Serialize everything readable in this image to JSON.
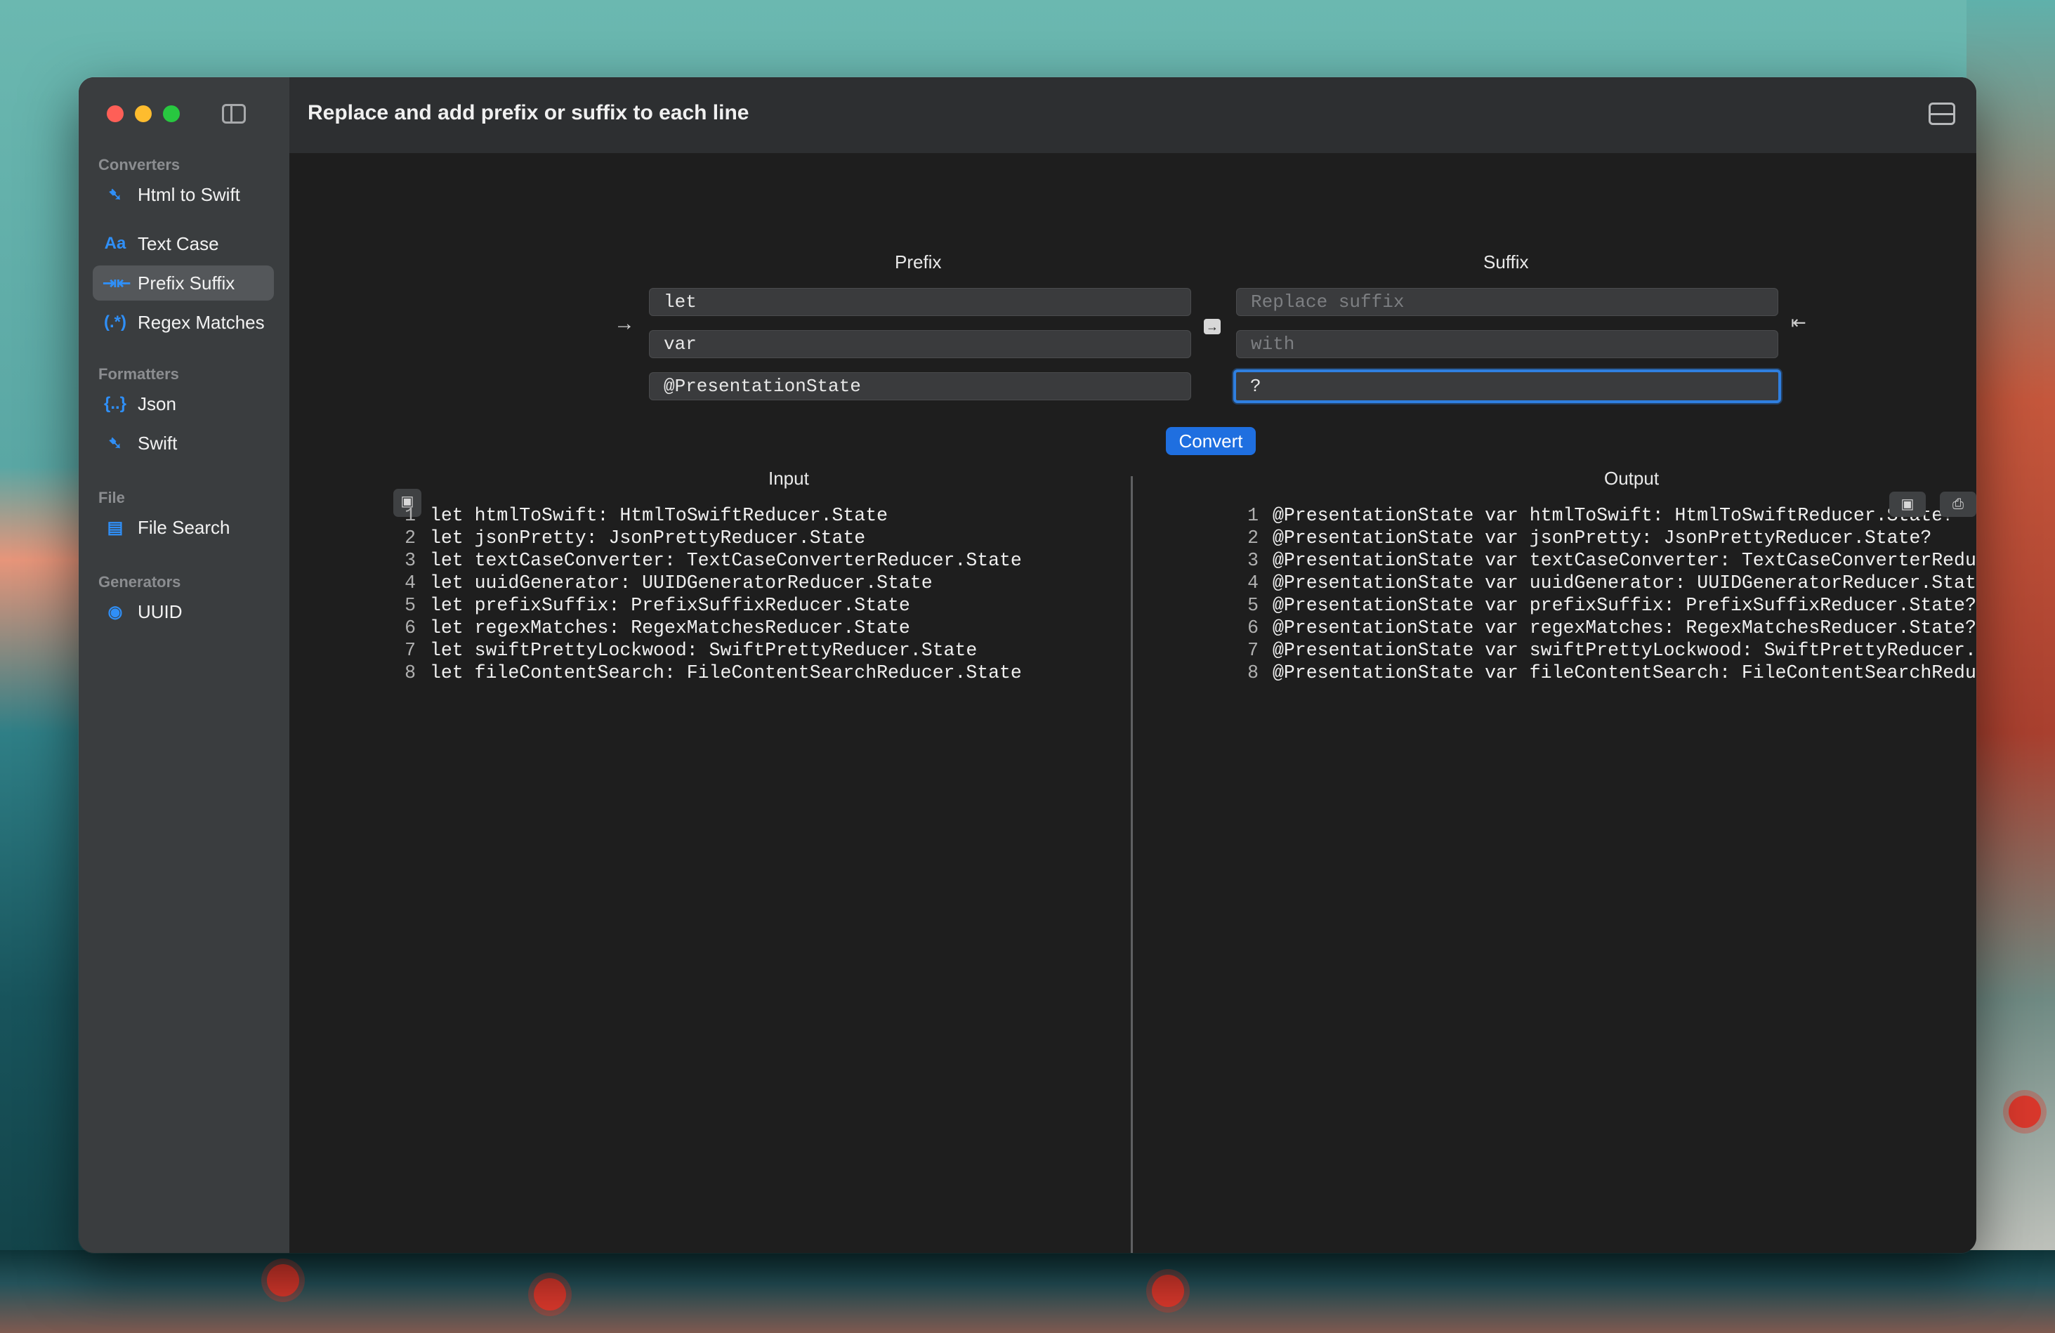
{
  "window": {
    "title": "Replace and add prefix or suffix to each line"
  },
  "sidebar": {
    "sections": [
      {
        "title": "Converters",
        "items": [
          {
            "label": "Html to Swift",
            "icon": "swift-bird-icon"
          },
          {
            "label": "Text Case",
            "icon": "text-case-icon"
          },
          {
            "label": "Prefix Suffix",
            "icon": "prefix-suffix-icon",
            "active": true
          },
          {
            "label": "Regex Matches",
            "icon": "regex-icon"
          }
        ]
      },
      {
        "title": "Formatters",
        "items": [
          {
            "label": "Json",
            "icon": "json-braces-icon"
          },
          {
            "label": "Swift",
            "icon": "swift-bird-icon"
          }
        ]
      },
      {
        "title": "File",
        "items": [
          {
            "label": "File Search",
            "icon": "file-search-icon"
          }
        ]
      },
      {
        "title": "Generators",
        "items": [
          {
            "label": "UUID",
            "icon": "uuid-icon"
          }
        ]
      }
    ]
  },
  "prefix": {
    "label": "Prefix",
    "replace_value": "let",
    "with_value": "var",
    "add_value": "@PresentationState"
  },
  "suffix": {
    "label": "Suffix",
    "replace_placeholder": "Replace suffix",
    "with_placeholder": "with",
    "add_value": "?"
  },
  "convert_label": "Convert",
  "input": {
    "label": "Input",
    "lines": [
      "let htmlToSwift: HtmlToSwiftReducer.State",
      "let jsonPretty: JsonPrettyReducer.State",
      "let textCaseConverter: TextCaseConverterReducer.State",
      "let uuidGenerator: UUIDGeneratorReducer.State",
      "let prefixSuffix: PrefixSuffixReducer.State",
      "let regexMatches: RegexMatchesReducer.State",
      "let swiftPrettyLockwood: SwiftPrettyReducer.State",
      "let fileContentSearch: FileContentSearchReducer.State"
    ]
  },
  "output": {
    "label": "Output",
    "lines": [
      "@PresentationState var htmlToSwift: HtmlToSwiftReducer.State?",
      "@PresentationState var jsonPretty: JsonPrettyReducer.State?",
      "@PresentationState var textCaseConverter: TextCaseConverterReducer.St",
      "@PresentationState var uuidGenerator: UUIDGeneratorReducer.State?",
      "@PresentationState var prefixSuffix: PrefixSuffixReducer.State?",
      "@PresentationState var regexMatches: RegexMatchesReducer.State?",
      "@PresentationState var swiftPrettyLockwood: SwiftPrettyReducer.State?",
      "@PresentationState var fileContentSearch: FileContentSearchReducer.St"
    ]
  },
  "line_numbers": [
    "1",
    "2",
    "3",
    "4",
    "5",
    "6",
    "7",
    "8"
  ],
  "colors": {
    "accent": "#1f6fe0",
    "sidebar_icon": "#2f8ff7"
  }
}
